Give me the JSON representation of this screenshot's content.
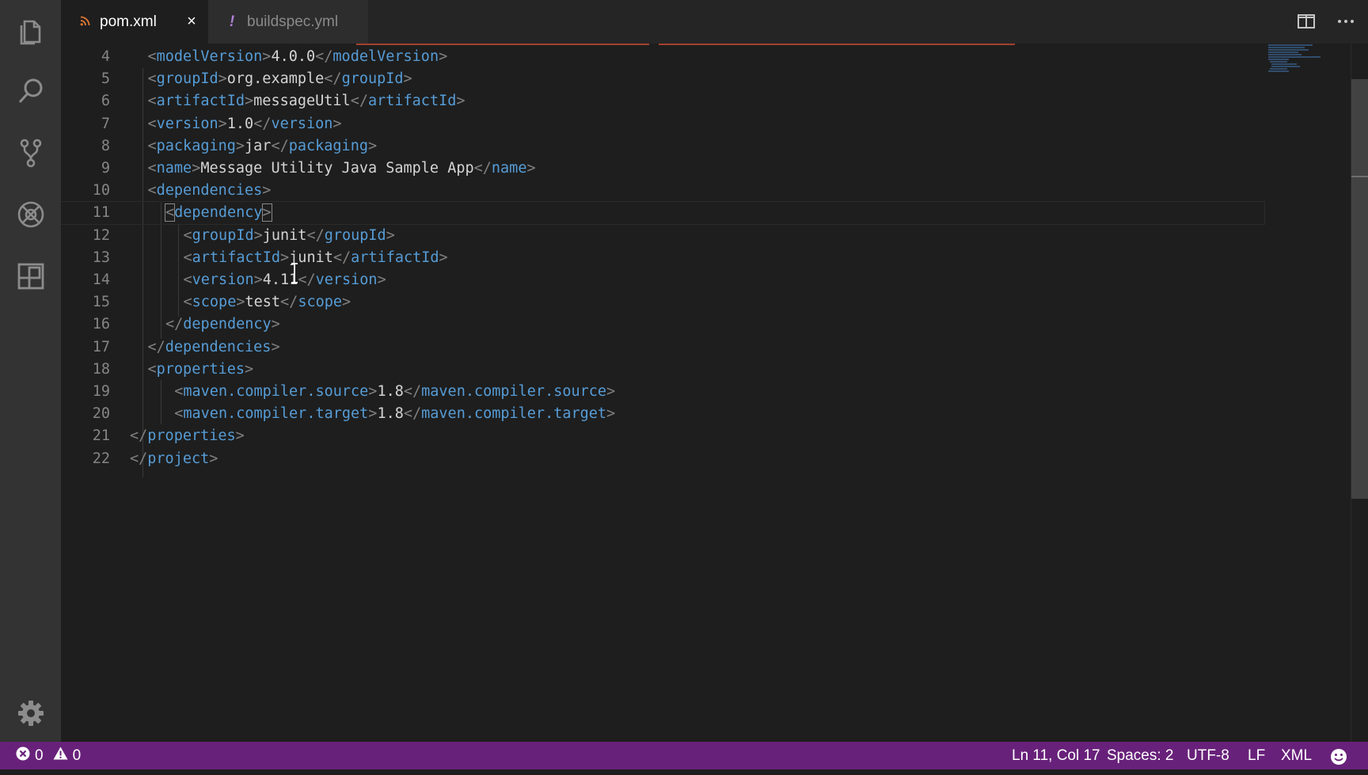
{
  "colors": {
    "activity_bar": "#333333",
    "editor_bg": "#1e1e1e",
    "status_bar": "#68217a",
    "tag": "#569cd6",
    "punctuation": "#808080",
    "text": "#d4d4d4",
    "line_number": "#858585"
  },
  "activity_bar": {
    "items": [
      "explorer-icon",
      "search-icon",
      "source-control-icon",
      "debug-icon",
      "extensions-icon"
    ],
    "bottom": "gear-icon"
  },
  "tabs": [
    {
      "label": "pom.xml",
      "icon": "rss-icon",
      "active": true,
      "close": "×"
    },
    {
      "label": "buildspec.yml",
      "icon": "!",
      "active": false
    }
  ],
  "editor": {
    "current_line": 11,
    "lines": [
      {
        "n": "4",
        "indent": 1,
        "tag": "modelVersion",
        "text": "4.0.0"
      },
      {
        "n": "5",
        "indent": 1,
        "tag": "groupId",
        "text": "org.example"
      },
      {
        "n": "6",
        "indent": 1,
        "tag": "artifactId",
        "text": "messageUtil"
      },
      {
        "n": "7",
        "indent": 1,
        "tag": "version",
        "text": "1.0"
      },
      {
        "n": "8",
        "indent": 1,
        "tag": "packaging",
        "text": "jar"
      },
      {
        "n": "9",
        "indent": 1,
        "tag": "name",
        "text": "Message Utility Java Sample App"
      },
      {
        "n": "10",
        "indent": 1,
        "open": "dependencies"
      },
      {
        "n": "11",
        "indent": 2,
        "open": "dependency",
        "boxed": true
      },
      {
        "n": "12",
        "indent": 3,
        "tag": "groupId",
        "text": "junit"
      },
      {
        "n": "13",
        "indent": 3,
        "tag": "artifactId",
        "text": "junit"
      },
      {
        "n": "14",
        "indent": 3,
        "tag": "version",
        "text": "4.11"
      },
      {
        "n": "15",
        "indent": 3,
        "tag": "scope",
        "text": "test"
      },
      {
        "n": "16",
        "indent": 2,
        "close": "dependency"
      },
      {
        "n": "17",
        "indent": 1,
        "close": "dependencies"
      },
      {
        "n": "18",
        "indent": 1,
        "open": "properties"
      },
      {
        "n": "19",
        "indent": 2.5,
        "tag": "maven.compiler.source",
        "text": "1.8"
      },
      {
        "n": "20",
        "indent": 2.5,
        "tag": "maven.compiler.target",
        "text": "1.8"
      },
      {
        "n": "21",
        "indent": 0,
        "close": "properties"
      },
      {
        "n": "22",
        "indent": 0,
        "close": "project"
      }
    ]
  },
  "status": {
    "errors": "0",
    "warnings": "0",
    "position": "Ln 11, Col 17",
    "spaces": "Spaces: 2",
    "encoding": "UTF-8",
    "eol": "LF",
    "language": "XML",
    "feedback_icon": "smiley-icon"
  }
}
